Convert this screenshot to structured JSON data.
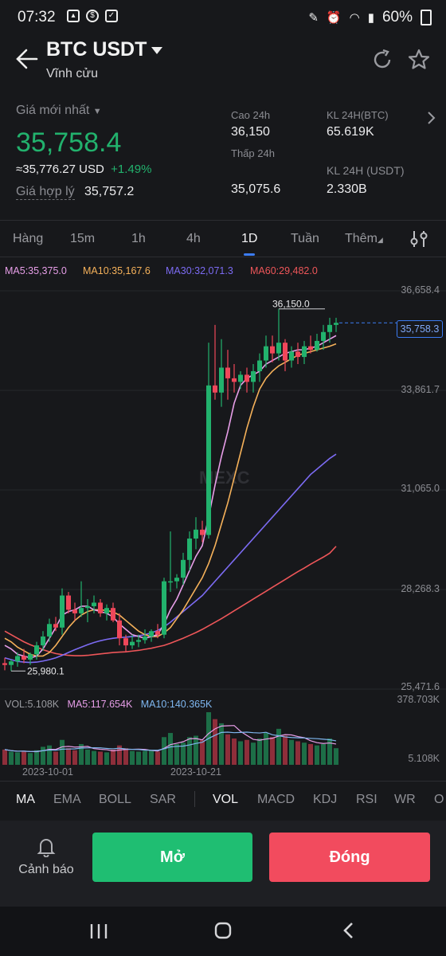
{
  "status_bar": {
    "time": "07:32",
    "battery": "60%"
  },
  "header": {
    "pair": "BTC USDT",
    "subtitle": "Vĩnh cửu"
  },
  "ticker": {
    "latest_label": "Giá mới nhất",
    "latest_price": "35,758.4",
    "usd_equiv": "≈35,776.27 USD",
    "change": "+1.49%",
    "fair_label": "Giá hợp lý",
    "fair_value": "35,757.2",
    "high_label": "Cao 24h",
    "high_value": "36,150",
    "low_label": "Thấp 24h",
    "low_value": "35,075.6",
    "vol_btc_label": "KL 24H(BTC)",
    "vol_btc_value": "65.619K",
    "vol_usdt_label": "KL 24H (USDT)",
    "vol_usdt_value": "2.330B"
  },
  "timeframes": [
    "Hàng",
    "15m",
    "1h",
    "4h",
    "1D",
    "Tuần",
    "Thêm"
  ],
  "active_timeframe": "1D",
  "ma_legend": {
    "ma5": "MA5:35,375.0",
    "ma10": "MA10:35,167.6",
    "ma30": "MA30:32,071.3",
    "ma60": "MA60:29,482.0"
  },
  "colors": {
    "up": "#22b26d",
    "down": "#f0475a",
    "ma5": "#e79ee8",
    "ma10": "#f5b15a",
    "ma30": "#7c6bf3",
    "ma60": "#ee5659",
    "accent": "#3c7cf3"
  },
  "chart_data": {
    "type": "candlestick",
    "y_ticks": [
      "36,658.4",
      "33,861.7",
      "31,065.0",
      "28,268.3",
      "25,471.6"
    ],
    "ylim": [
      25471.6,
      36658.4
    ],
    "high_marker": "36,150.0",
    "low_marker": "25,980.1",
    "current_price": "35,758.3",
    "x_ticks": [
      "2023-10-01",
      "2023-10-21"
    ],
    "candles": [
      [
        26200,
        26350,
        26000,
        26150
      ],
      [
        26150,
        26300,
        25980,
        26250
      ],
      [
        26250,
        26500,
        26100,
        26400
      ],
      [
        26400,
        26600,
        26200,
        26300
      ],
      [
        26300,
        26500,
        26150,
        26450
      ],
      [
        26450,
        26800,
        26300,
        26700
      ],
      [
        26700,
        27100,
        26550,
        26950
      ],
      [
        26950,
        27450,
        26800,
        27300
      ],
      [
        27300,
        27500,
        27100,
        27200
      ],
      [
        27200,
        28300,
        27000,
        28100
      ],
      [
        28100,
        28200,
        27600,
        27700
      ],
      [
        27700,
        27900,
        27400,
        27600
      ],
      [
        27600,
        28500,
        27500,
        27750
      ],
      [
        27750,
        28000,
        27350,
        27800
      ],
      [
        27800,
        28100,
        27600,
        27900
      ],
      [
        27900,
        28000,
        27500,
        27600
      ],
      [
        27600,
        27850,
        27400,
        27750
      ],
      [
        27750,
        27900,
        27350,
        27400
      ],
      [
        27400,
        27600,
        26700,
        26900
      ],
      [
        26900,
        27000,
        26500,
        26700
      ],
      [
        26700,
        27000,
        26600,
        26800
      ],
      [
        26800,
        27000,
        26650,
        26850
      ],
      [
        26850,
        27150,
        26750,
        26950
      ],
      [
        26950,
        27150,
        26800,
        27100
      ],
      [
        27100,
        27300,
        26900,
        27000
      ],
      [
        27000,
        28600,
        26900,
        28500
      ],
      [
        28500,
        29900,
        28200,
        28500
      ],
      [
        28500,
        28700,
        28300,
        28600
      ],
      [
        28600,
        29300,
        28400,
        29100
      ],
      [
        29100,
        29900,
        28800,
        29700
      ],
      [
        29700,
        30300,
        29400,
        29950
      ],
      [
        29950,
        30200,
        29600,
        29800
      ],
      [
        29800,
        35200,
        29700,
        34000
      ],
      [
        34000,
        35700,
        33600,
        33800
      ],
      [
        33800,
        35300,
        33400,
        34500
      ],
      [
        34500,
        35000,
        33600,
        34200
      ],
      [
        34200,
        34600,
        33800,
        34100
      ],
      [
        34100,
        34400,
        33900,
        34300
      ],
      [
        34300,
        34500,
        33800,
        34100
      ],
      [
        34100,
        34600,
        33800,
        34400
      ],
      [
        34400,
        34900,
        34100,
        34700
      ],
      [
        34700,
        35400,
        34500,
        35100
      ],
      [
        35100,
        35400,
        34650,
        34900
      ],
      [
        34900,
        36150,
        34700,
        35200
      ],
      [
        35200,
        35300,
        34400,
        34700
      ],
      [
        34700,
        35100,
        34500,
        34950
      ],
      [
        34950,
        35200,
        34600,
        34800
      ],
      [
        34800,
        35250,
        34600,
        35100
      ],
      [
        35100,
        35400,
        34900,
        35000
      ],
      [
        35000,
        35450,
        34950,
        35250
      ],
      [
        35250,
        35700,
        35000,
        35500
      ],
      [
        35500,
        35900,
        35200,
        35700
      ],
      [
        35700,
        35900,
        35500,
        35758
      ]
    ],
    "ma5": [
      26700,
      26600,
      26450,
      26400,
      26350,
      26400,
      26600,
      26900,
      27200,
      27550,
      27650,
      27700,
      27800,
      27800,
      27700,
      27650,
      27600,
      27500,
      27300,
      27150,
      27000,
      26950,
      26900,
      26950,
      27000,
      27300,
      27700,
      28000,
      28400,
      28800,
      29200,
      29500,
      30300,
      31200,
      32000,
      32700,
      33500,
      34000,
      34200,
      34300,
      34400,
      34600,
      34700,
      34800,
      34900,
      34950,
      35000,
      35000,
      35050,
      35100,
      35200,
      35300,
      35400
    ],
    "ma10": [
      26900,
      26800,
      26650,
      26550,
      26450,
      26400,
      26400,
      26500,
      26700,
      26950,
      27200,
      27400,
      27550,
      27650,
      27700,
      27700,
      27680,
      27640,
      27550,
      27400,
      27250,
      27100,
      27000,
      26950,
      26950,
      27050,
      27200,
      27450,
      27700,
      28000,
      28300,
      28600,
      29000,
      29500,
      30100,
      30700,
      31400,
      32100,
      32800,
      33400,
      33900,
      34200,
      34400,
      34550,
      34650,
      34750,
      34850,
      34900,
      34950,
      35000,
      35050,
      35100,
      35168
    ],
    "ma30": [
      26350,
      26300,
      26250,
      26230,
      26220,
      26230,
      26260,
      26300,
      26350,
      26420,
      26500,
      26580,
      26650,
      26720,
      26780,
      26830,
      26870,
      26900,
      26920,
      26930,
      26950,
      26970,
      27000,
      27050,
      27120,
      27220,
      27350,
      27500,
      27650,
      27800,
      27950,
      28100,
      28300,
      28500,
      28700,
      28900,
      29100,
      29300,
      29500,
      29700,
      29900,
      30100,
      30300,
      30500,
      30700,
      30900,
      31100,
      31300,
      31500,
      31650,
      31800,
      31950,
      32071
    ],
    "ma60": [
      27100,
      27000,
      26900,
      26800,
      26720,
      26650,
      26580,
      26520,
      26470,
      26440,
      26420,
      26410,
      26410,
      26420,
      26440,
      26460,
      26480,
      26500,
      26510,
      26520,
      26540,
      26560,
      26590,
      26620,
      26660,
      26700,
      26760,
      26830,
      26900,
      26980,
      27060,
      27150,
      27250,
      27350,
      27450,
      27560,
      27670,
      27780,
      27890,
      28000,
      28110,
      28220,
      28330,
      28440,
      28550,
      28660,
      28770,
      28870,
      28980,
      29080,
      29180,
      29290,
      29482
    ]
  },
  "volume_panel": {
    "vol_label": "VOL:5.108K",
    "ma5_label": "MA5:117.654K",
    "ma10_label": "MA10:140.365K",
    "max_label": "378.703K",
    "min_label": "5.108K",
    "values": [
      110,
      95,
      90,
      100,
      85,
      105,
      130,
      140,
      95,
      180,
      120,
      105,
      150,
      110,
      100,
      95,
      90,
      110,
      140,
      120,
      100,
      95,
      100,
      105,
      95,
      200,
      230,
      150,
      160,
      200,
      210,
      180,
      380,
      330,
      300,
      220,
      190,
      170,
      180,
      160,
      190,
      230,
      200,
      260,
      210,
      180,
      170,
      160,
      150,
      140,
      150,
      190,
      120
    ]
  },
  "x_tick_labels": [
    "2023-10-01",
    "2023-10-21"
  ],
  "indicators": [
    "MA",
    "EMA",
    "BOLL",
    "SAR",
    "VOL",
    "MACD",
    "KDJ",
    "RSI",
    "WR",
    "O"
  ],
  "indicators_active": [
    "MA",
    "VOL"
  ],
  "bottom": {
    "alert_label": "Cảnh báo",
    "open_label": "Mở",
    "close_label": "Đóng"
  },
  "watermark": "MEXC"
}
